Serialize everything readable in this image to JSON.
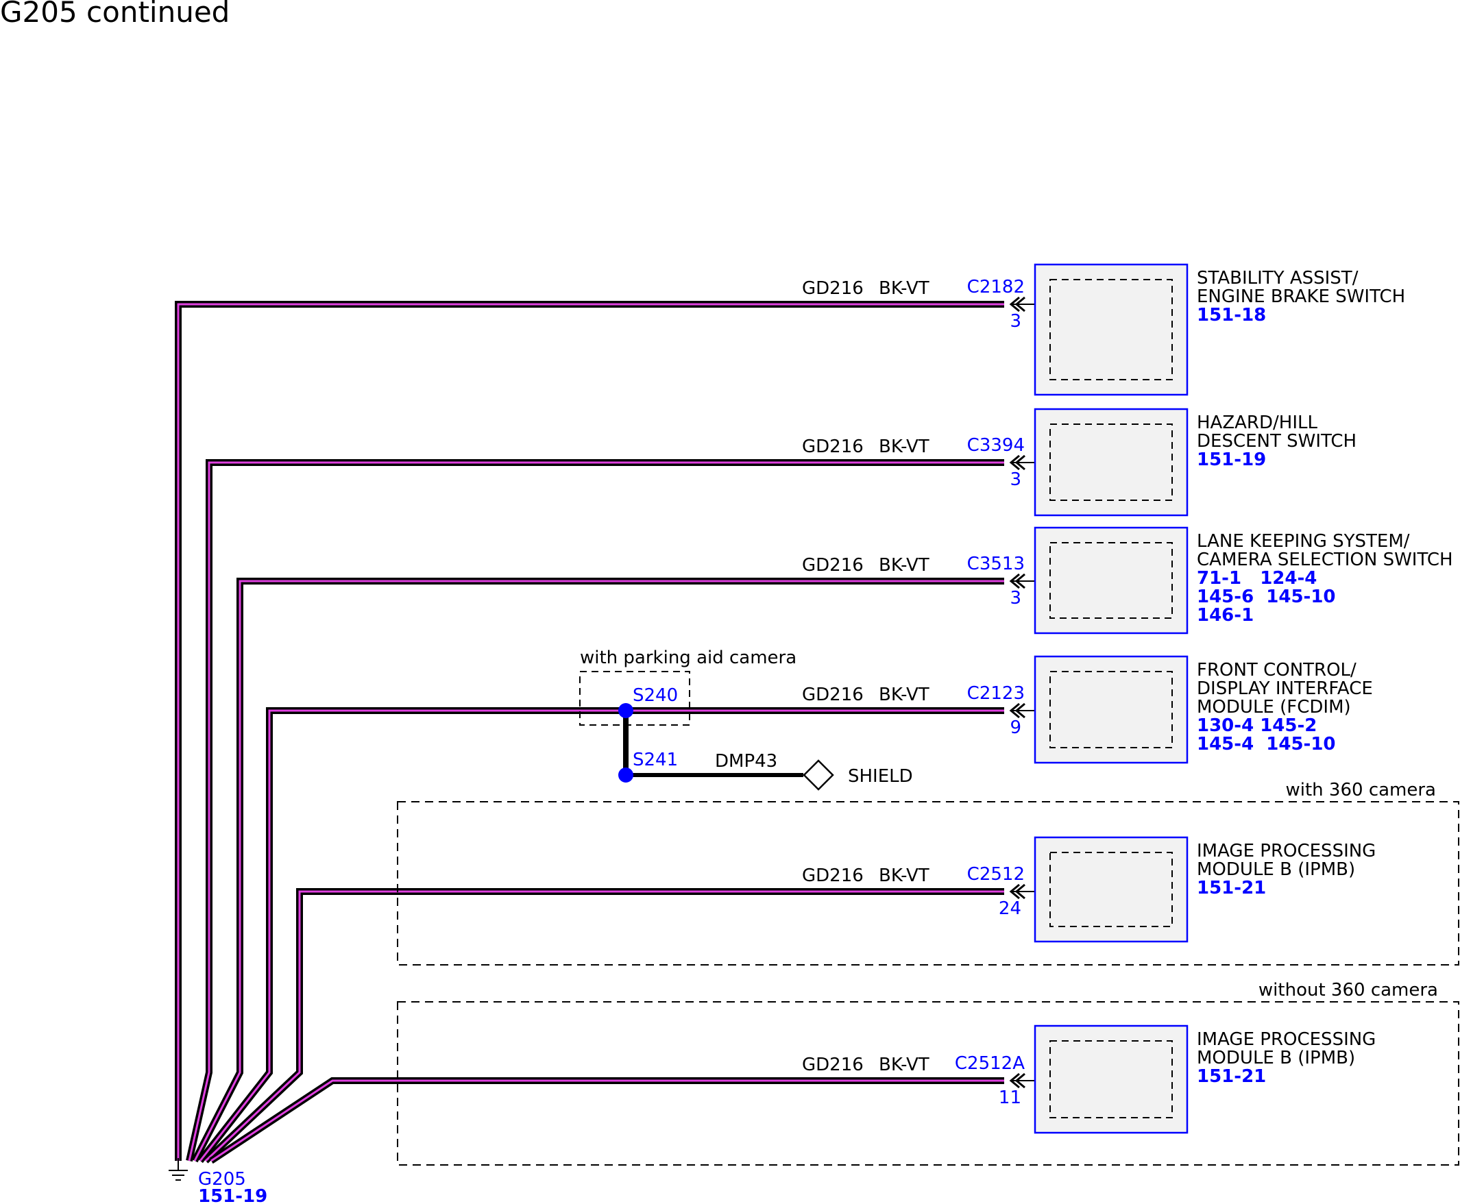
{
  "page": {
    "title": "G205 continued"
  },
  "ground": {
    "id": "G205",
    "ref": "151-19"
  },
  "wires": [
    {
      "circuit": "GD216",
      "color": "BK-VT",
      "connector": "C2182",
      "pin": "3"
    },
    {
      "circuit": "GD216",
      "color": "BK-VT",
      "connector": "C3394",
      "pin": "3"
    },
    {
      "circuit": "GD216",
      "color": "BK-VT",
      "connector": "C3513",
      "pin": "3"
    },
    {
      "circuit": "GD216",
      "color": "BK-VT",
      "connector": "C2123",
      "pin": "9"
    },
    {
      "circuit": "GD216",
      "color": "BK-VT",
      "connector": "C2512",
      "pin": "24"
    },
    {
      "circuit": "GD216",
      "color": "BK-VT",
      "connector": "C2512A",
      "pin": "11"
    }
  ],
  "components": [
    {
      "name_lines": [
        "STABILITY ASSIST/",
        "ENGINE BRAKE SWITCH"
      ],
      "ref_lines": [
        "151-18"
      ]
    },
    {
      "name_lines": [
        "HAZARD/HILL",
        "DESCENT SWITCH"
      ],
      "ref_lines": [
        "151-19"
      ]
    },
    {
      "name_lines": [
        "LANE KEEPING SYSTEM/",
        "CAMERA SELECTION SWITCH"
      ],
      "ref_lines": [
        "71-1   124-4",
        "145-6  145-10",
        "146-1"
      ]
    },
    {
      "name_lines": [
        "FRONT CONTROL/",
        "DISPLAY INTERFACE",
        "MODULE (FCDIM)"
      ],
      "ref_lines": [
        "130-4 145-2",
        "145-4  145-10"
      ]
    },
    {
      "name_lines": [
        "IMAGE PROCESSING",
        "MODULE B (IPMB)"
      ],
      "ref_lines": [
        "151-21"
      ]
    },
    {
      "name_lines": [
        "IMAGE PROCESSING",
        "MODULE B (IPMB)"
      ],
      "ref_lines": [
        "151-21"
      ]
    }
  ],
  "splices": {
    "option_label": "with parking aid camera",
    "s240": "S240",
    "s241": "S241",
    "drain_circuit": "DMP43",
    "shield_label": "SHIELD"
  },
  "options": {
    "with_360": "with 360 camera",
    "without_360": "without 360 camera"
  },
  "colors": {
    "wire_outer": "#000000",
    "wire_inner": "#e040e0",
    "connector_text": "#0000ff",
    "component_border": "#0000ff",
    "component_fill": "#f2f2f2",
    "splice_dot": "#0000ff"
  }
}
